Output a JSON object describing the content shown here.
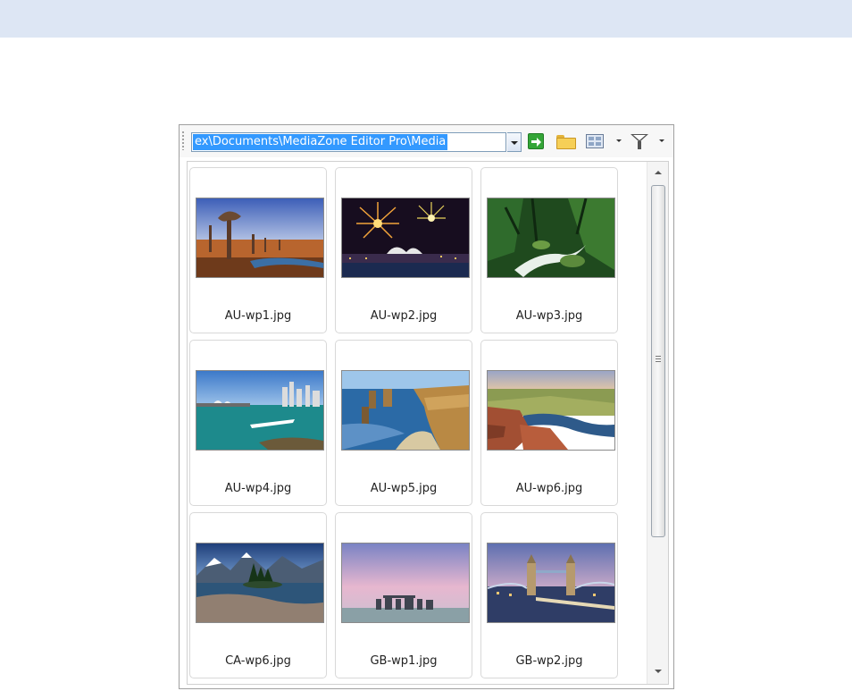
{
  "toolbar": {
    "path": "ex\\Documents\\MediaZone Editor Pro\\Media",
    "icons": [
      "go-icon",
      "folder-icon",
      "view-mode-icon",
      "filter-icon"
    ]
  },
  "files": [
    {
      "name": "AU-wp1.jpg"
    },
    {
      "name": "AU-wp2.jpg"
    },
    {
      "name": "AU-wp3.jpg"
    },
    {
      "name": "AU-wp4.jpg"
    },
    {
      "name": "AU-wp5.jpg"
    },
    {
      "name": "AU-wp6.jpg"
    },
    {
      "name": "CA-wp6.jpg"
    },
    {
      "name": "GB-wp1.jpg"
    },
    {
      "name": "GB-wp2.jpg"
    }
  ],
  "colors": {
    "top_band": "#dde6f4",
    "selection": "#3399ff"
  }
}
